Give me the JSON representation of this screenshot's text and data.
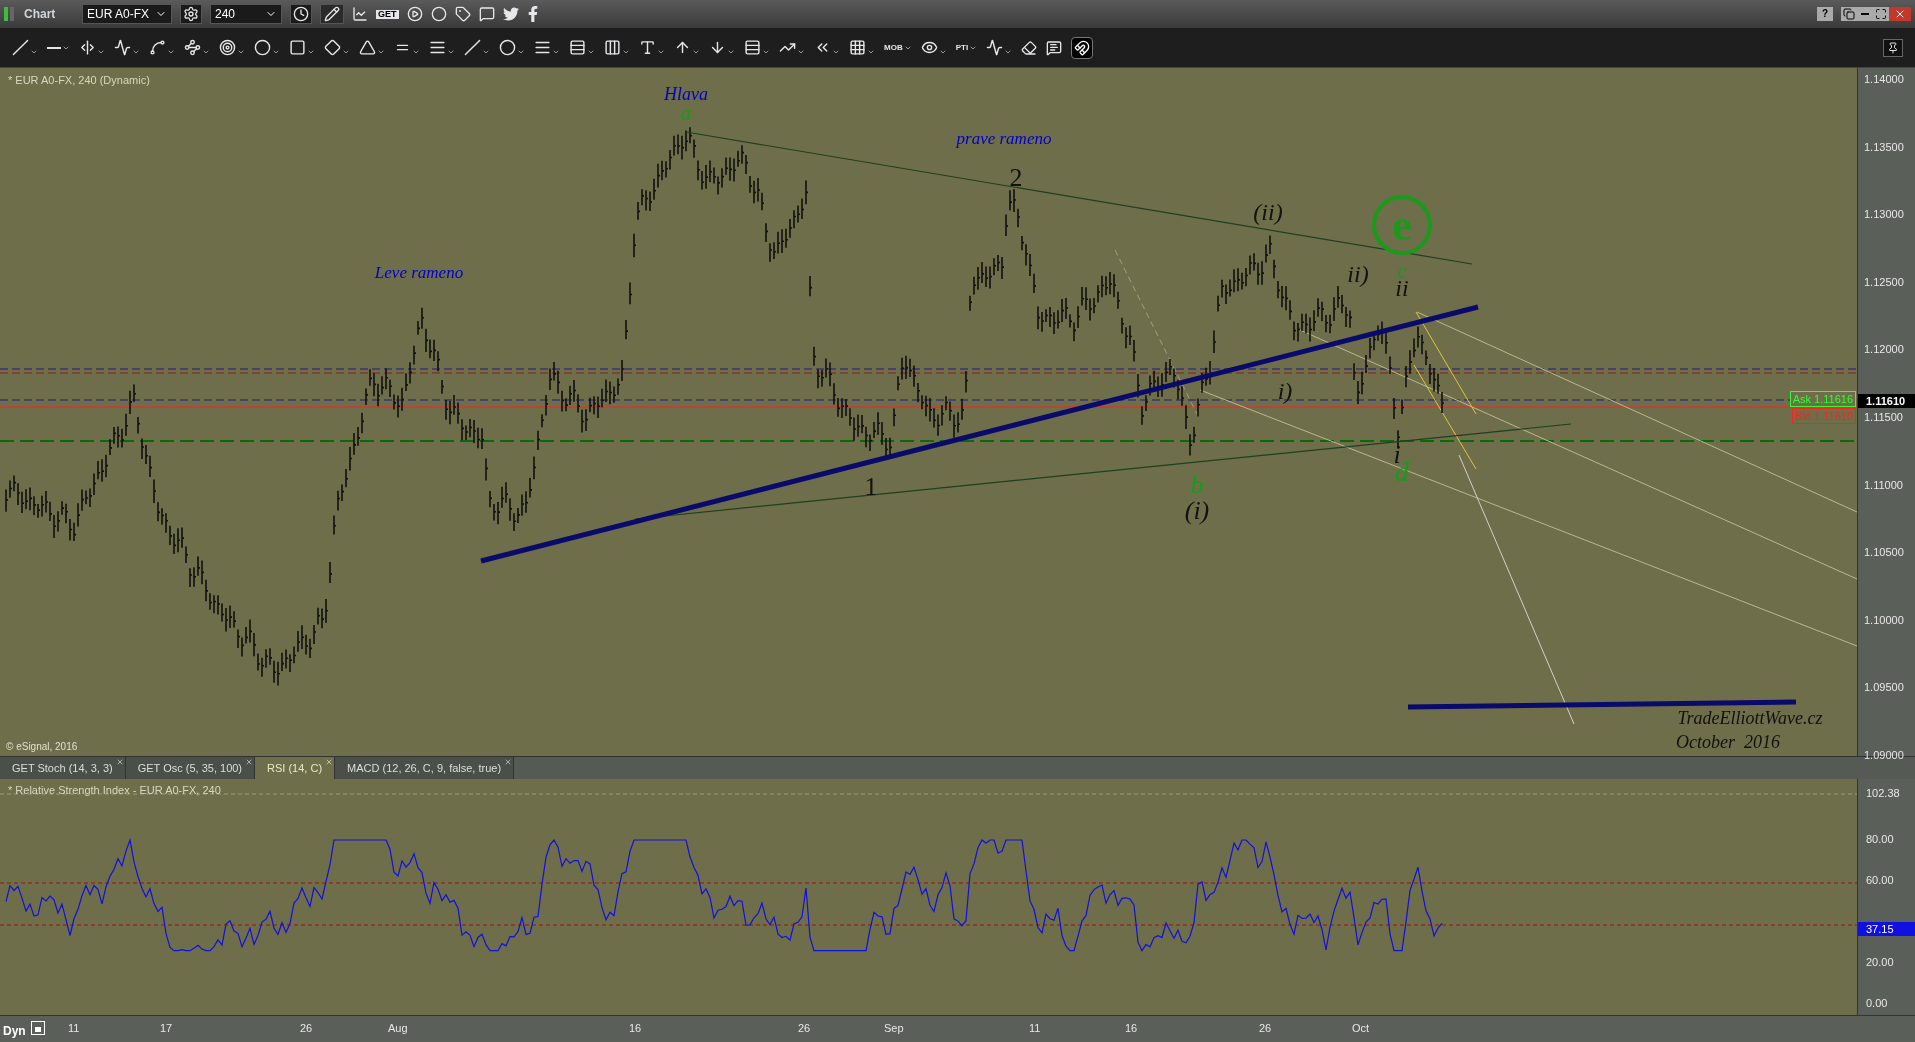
{
  "window": {
    "title": "Chart",
    "help": "?"
  },
  "toolbar": {
    "symbol": "EUR A0-FX",
    "interval": "240",
    "get_label": "GET",
    "tool_labels": [
      "MOB",
      "PTI"
    ]
  },
  "chart": {
    "title": "* EUR A0-FX, 240 (Dynamic)",
    "copyright": "© eSignal, 2016",
    "price_axis": [
      "1.14000",
      "1.13500",
      "1.13000",
      "1.12500",
      "1.12000",
      "1.11500",
      "1.11000",
      "1.10500",
      "1.10000",
      "1.09500",
      "1.09000"
    ],
    "ask": "Ask 1.11616",
    "bid": "Bid 1.11610",
    "last": "1.11610",
    "annotations": [
      {
        "text": "Hlava",
        "kind": "label",
        "color": "#0000cc"
      },
      {
        "text": "a",
        "kind": "wave",
        "color": "#1a9a1a"
      },
      {
        "text": "prave rameno",
        "kind": "label",
        "color": "#0000cc"
      },
      {
        "text": "2",
        "kind": "wave",
        "color": "#111111"
      },
      {
        "text": "Leve rameno",
        "kind": "label",
        "color": "#0000cc"
      },
      {
        "text": "(ii)",
        "kind": "wave",
        "color": "#111111"
      },
      {
        "text": "e",
        "kind": "circled",
        "color": "#1a9a1a"
      },
      {
        "text": "ii)",
        "kind": "wave",
        "color": "#111111"
      },
      {
        "text": "c",
        "kind": "wave",
        "color": "#1a9a1a"
      },
      {
        "text": "ii",
        "kind": "wave",
        "color": "#111111"
      },
      {
        "text": "i)",
        "kind": "wave",
        "color": "#111111"
      },
      {
        "text": "i",
        "kind": "wave",
        "color": "#111111"
      },
      {
        "text": "d",
        "kind": "wave",
        "color": "#1a9a1a"
      },
      {
        "text": "1",
        "kind": "wave",
        "color": "#111111"
      },
      {
        "text": "b",
        "kind": "wave",
        "color": "#1a9a1a"
      },
      {
        "text": "(i)",
        "kind": "wave",
        "color": "#111111"
      }
    ],
    "signature": [
      "TradeElliottWave.cz",
      "October  2016"
    ]
  },
  "indicator_tabs": [
    {
      "label": "GET Stoch (14, 3, 3)",
      "selected": false
    },
    {
      "label": "GET Osc (5, 35, 100)",
      "selected": false
    },
    {
      "label": "RSI (14, C)",
      "selected": true
    },
    {
      "label": "MACD (12, 26, C, 9, false, true)",
      "selected": false
    }
  ],
  "rsi": {
    "title": "* Relative Strength Index - EUR A0-FX, 240",
    "axis": [
      "102.38",
      "80.00",
      "60.00",
      "20.00",
      "0.00"
    ],
    "last": "37.15"
  },
  "date_axis": {
    "mode": "Dyn",
    "labels": [
      "11",
      "17",
      "26",
      "Aug",
      "16",
      "26",
      "Sep",
      "11",
      "16",
      "26",
      "Oct"
    ]
  }
}
